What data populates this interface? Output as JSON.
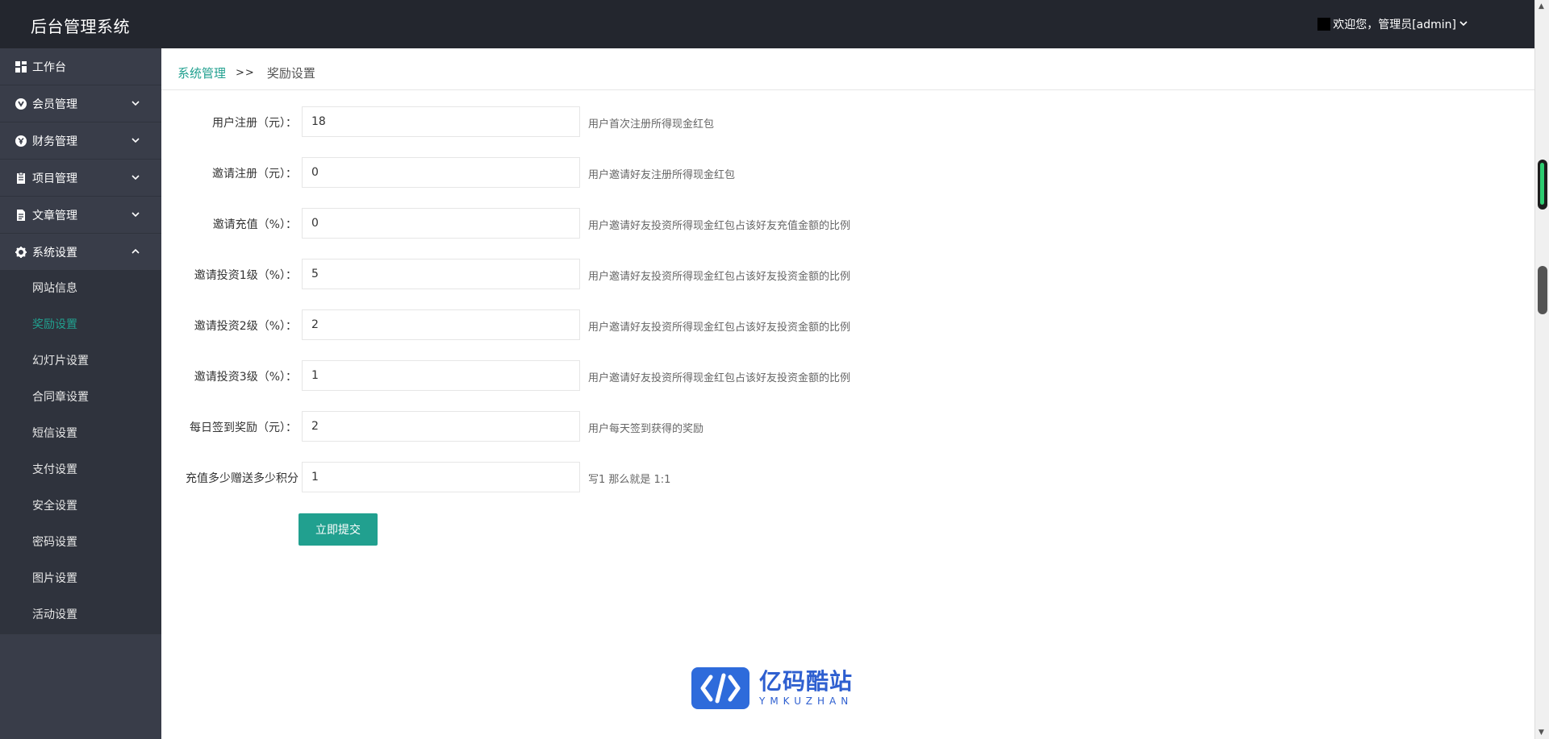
{
  "app": {
    "title": "后台管理系统"
  },
  "user": {
    "greeting": "欢迎您，管理员[admin]"
  },
  "sidebar": {
    "items": [
      {
        "label": "工作台",
        "icon": "dashboard-icon",
        "expandable": false
      },
      {
        "label": "会员管理",
        "icon": "member-icon",
        "expandable": true,
        "expanded": false
      },
      {
        "label": "财务管理",
        "icon": "finance-icon",
        "expandable": true,
        "expanded": false
      },
      {
        "label": "项目管理",
        "icon": "project-icon",
        "expandable": true,
        "expanded": false
      },
      {
        "label": "文章管理",
        "icon": "article-icon",
        "expandable": true,
        "expanded": false
      },
      {
        "label": "系统设置",
        "icon": "gear-icon",
        "expandable": true,
        "expanded": true
      }
    ],
    "subitems": [
      {
        "label": "网站信息",
        "active": false
      },
      {
        "label": "奖励设置",
        "active": true
      },
      {
        "label": "幻灯片设置",
        "active": false
      },
      {
        "label": "合同章设置",
        "active": false
      },
      {
        "label": "短信设置",
        "active": false
      },
      {
        "label": "支付设置",
        "active": false
      },
      {
        "label": "安全设置",
        "active": false
      },
      {
        "label": "密码设置",
        "active": false
      },
      {
        "label": "图片设置",
        "active": false
      },
      {
        "label": "活动设置",
        "active": false
      }
    ]
  },
  "breadcrumb": {
    "parent": "系统管理",
    "separator": ">>",
    "current": "奖励设置"
  },
  "form": {
    "rows": [
      {
        "label": "用户注册（元）：",
        "value": "18",
        "hint": "用户首次注册所得现金红包"
      },
      {
        "label": "邀请注册（元）：",
        "value": "0",
        "hint": "用户邀请好友注册所得现金红包"
      },
      {
        "label": "邀请充值（%）：",
        "value": "0",
        "hint": "用户邀请好友投资所得现金红包占该好友充值金额的比例"
      },
      {
        "label": "邀请投资1级（%）：",
        "value": "5",
        "hint": "用户邀请好友投资所得现金红包占该好友投资金额的比例"
      },
      {
        "label": "邀请投资2级（%）：",
        "value": "2",
        "hint": "用户邀请好友投资所得现金红包占该好友投资金额的比例"
      },
      {
        "label": "邀请投资3级（%）：",
        "value": "1",
        "hint": "用户邀请好友投资所得现金红包占该好友投资金额的比例"
      },
      {
        "label": "每日签到奖励（元）：",
        "value": "2",
        "hint": "用户每天签到获得的奖励"
      },
      {
        "label": "充值多少赠送多少积分",
        "value": "1",
        "hint": "写1 那么就是 1:1"
      }
    ],
    "submit_label": "立即提交"
  },
  "watermark": {
    "cn": "亿码酷站",
    "en": "YMKUZHAN"
  },
  "colors": {
    "accent": "#21a08f",
    "topbar": "#23262e",
    "sidebar": "#393d49",
    "logo": "#2e6bdb"
  }
}
